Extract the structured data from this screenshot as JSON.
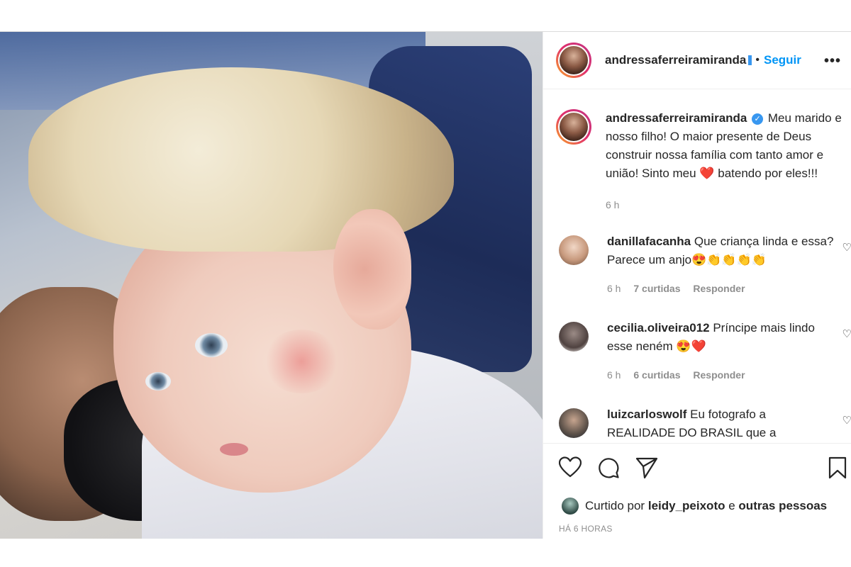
{
  "post_header": {
    "username": "andressaferreiramiranda",
    "separator": "•",
    "follow_label": "Seguir",
    "more_label": "•••"
  },
  "caption": {
    "username": "andressaferreiramiranda",
    "text_part1": "Meu marido e nosso filho! O maior presente de Deus construir nossa família com tanto amor e união! Sinto meu",
    "heart": "❤️",
    "text_part2": "batendo por eles!!!",
    "time": "6 h"
  },
  "comments": [
    {
      "username": "danillafacanha",
      "text": "Que criança linda e essa? Parece um anjo😍👏👏👏👏",
      "time": "6 h",
      "likes": "7 curtidas",
      "reply": "Responder",
      "avatar_color": "#d9b8a3"
    },
    {
      "username": "cecilia.oliveira012",
      "text": "Príncipe mais lindo esse neném 😍❤️",
      "time": "6 h",
      "likes": "6 curtidas",
      "reply": "Responder",
      "avatar_color": "#6b5a55"
    },
    {
      "username": "luizcarloswolf",
      "text": "Eu fotografo a REALIDADE DO BRASIL que a",
      "avatar_color": "#4a4f57"
    }
  ],
  "actions": {
    "liked_by_prefix": "Curtido por",
    "liked_by_user": "leidy_peixoto",
    "liked_by_and": "e",
    "liked_by_others": "outras pessoas",
    "time_ago": "HÁ 6 HORAS"
  },
  "icons": {
    "like": "heart-icon",
    "comment": "comment-icon",
    "share": "send-icon",
    "save": "bookmark-icon"
  },
  "colors": {
    "accent_blue": "#0095f6",
    "text": "#262626",
    "muted": "#8e8e8e"
  }
}
